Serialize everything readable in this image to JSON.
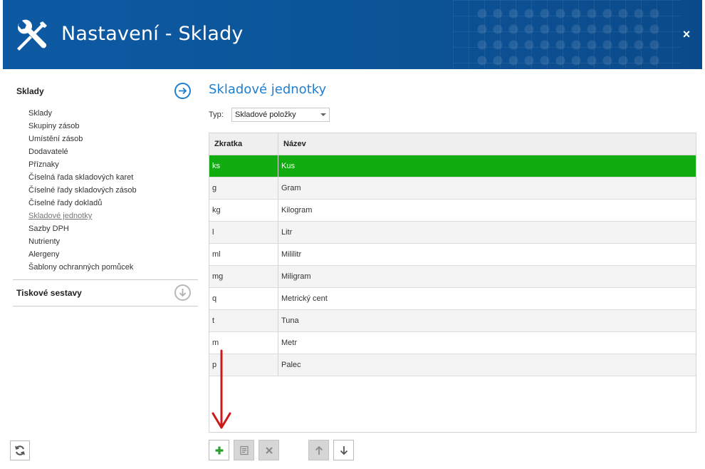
{
  "window": {
    "title": "Nastavení - Sklady",
    "close_label": "×",
    "accent_color": "#0c5398"
  },
  "sidebar": {
    "sections": [
      {
        "title": "Sklady",
        "expanded": true,
        "icon": "arrow-right-circle-icon",
        "items": [
          {
            "label": "Sklady"
          },
          {
            "label": "Skupiny zásob"
          },
          {
            "label": "Umístění zásob"
          },
          {
            "label": "Dodavatelé"
          },
          {
            "label": "Příznaky"
          },
          {
            "label": "Číselná řada skladových karet"
          },
          {
            "label": "Číselné řady skladových zásob"
          },
          {
            "label": "Číselné řady dokladů"
          },
          {
            "label": "Skladové jednotky",
            "active": true
          },
          {
            "label": "Sazby DPH"
          },
          {
            "label": "Nutrienty"
          },
          {
            "label": "Alergeny"
          },
          {
            "label": "Šablony ochranných pomůcek"
          }
        ]
      },
      {
        "title": "Tiskové sestavy",
        "expanded": false,
        "icon": "arrow-down-circle-icon"
      }
    ]
  },
  "main": {
    "title": "Skladové jednotky",
    "type_label": "Typ:",
    "type_value": "Skladové položky",
    "table": {
      "columns": [
        "Zkratka",
        "Název"
      ],
      "rows": [
        {
          "abbr": "ks",
          "name": "Kus",
          "selected": true
        },
        {
          "abbr": "g",
          "name": "Gram"
        },
        {
          "abbr": "kg",
          "name": "Kilogram"
        },
        {
          "abbr": "l",
          "name": "Litr"
        },
        {
          "abbr": "ml",
          "name": "Mililitr"
        },
        {
          "abbr": "mg",
          "name": "Miligram"
        },
        {
          "abbr": "q",
          "name": "Metrický cent"
        },
        {
          "abbr": "t",
          "name": "Tuna"
        },
        {
          "abbr": "m",
          "name": "Metr"
        },
        {
          "abbr": "p",
          "name": "Palec"
        }
      ],
      "selected_color": "#10ac10"
    }
  },
  "toolbar": {
    "buttons": [
      {
        "icon": "plus-icon",
        "enabled": true
      },
      {
        "icon": "edit-icon",
        "enabled": false
      },
      {
        "icon": "delete-icon",
        "enabled": false
      },
      {
        "icon": "move-up-icon",
        "enabled": false
      },
      {
        "icon": "move-down-icon",
        "enabled": true
      }
    ]
  },
  "footer": {
    "refresh_icon": "refresh-icon"
  },
  "annotation": {
    "arrow_color": "#cc1a1a"
  }
}
